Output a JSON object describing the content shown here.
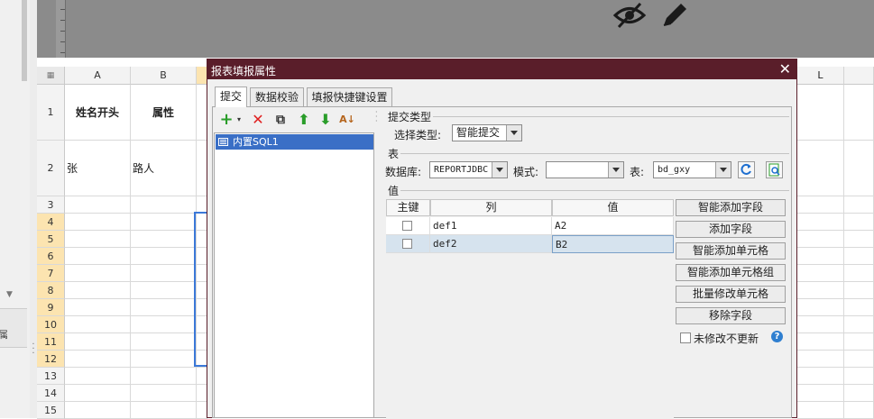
{
  "spreadsheet": {
    "columns": [
      "A",
      "B",
      "L"
    ],
    "rows": [
      {
        "num": "1",
        "a": "姓名开头",
        "b": "属性"
      },
      {
        "num": "2",
        "a": "张",
        "b": "路人"
      },
      {
        "num": "3"
      },
      {
        "num": "4"
      },
      {
        "num": "5"
      },
      {
        "num": "6"
      },
      {
        "num": "7"
      },
      {
        "num": "8"
      },
      {
        "num": "9"
      },
      {
        "num": "10"
      },
      {
        "num": "11"
      },
      {
        "num": "12"
      },
      {
        "num": "13"
      },
      {
        "num": "14"
      },
      {
        "num": "15"
      }
    ]
  },
  "left_panel": {
    "tab_label": "属"
  },
  "dialog": {
    "title": "报表填报属性",
    "close": "✕",
    "tabs": [
      {
        "label": "提交",
        "active": true
      },
      {
        "label": "数据校验",
        "active": false
      },
      {
        "label": "填报快捷键设置",
        "active": false
      }
    ],
    "sql_list": [
      "内置SQL1"
    ],
    "submit_type": {
      "group_label": "提交类型",
      "select_label": "选择类型:",
      "value": "智能提交"
    },
    "table_group": {
      "group_label": "表",
      "database_label": "数据库:",
      "database_value": "REPORTJDBC",
      "schema_label": "模式:",
      "schema_value": "",
      "table_label": "表:",
      "table_value": "bd_gxy"
    },
    "value_group": {
      "group_label": "值",
      "headers": [
        "主键",
        "列",
        "值"
      ],
      "rows": [
        {
          "column": "def1",
          "value": "A2",
          "selected": false
        },
        {
          "column": "def2",
          "value": "B2",
          "selected": true
        }
      ]
    },
    "buttons": [
      "智能添加字段",
      "添加字段",
      "智能添加单元格",
      "智能添加单元格组",
      "批量修改单元格",
      "移除字段"
    ],
    "no_update_label": "未修改不更新",
    "help": "?"
  },
  "colors": {
    "dialog_title_bg": "#5a1e2a",
    "selection_blue": "#3a6fc6",
    "row_header_highlight": "#fce4b0"
  }
}
